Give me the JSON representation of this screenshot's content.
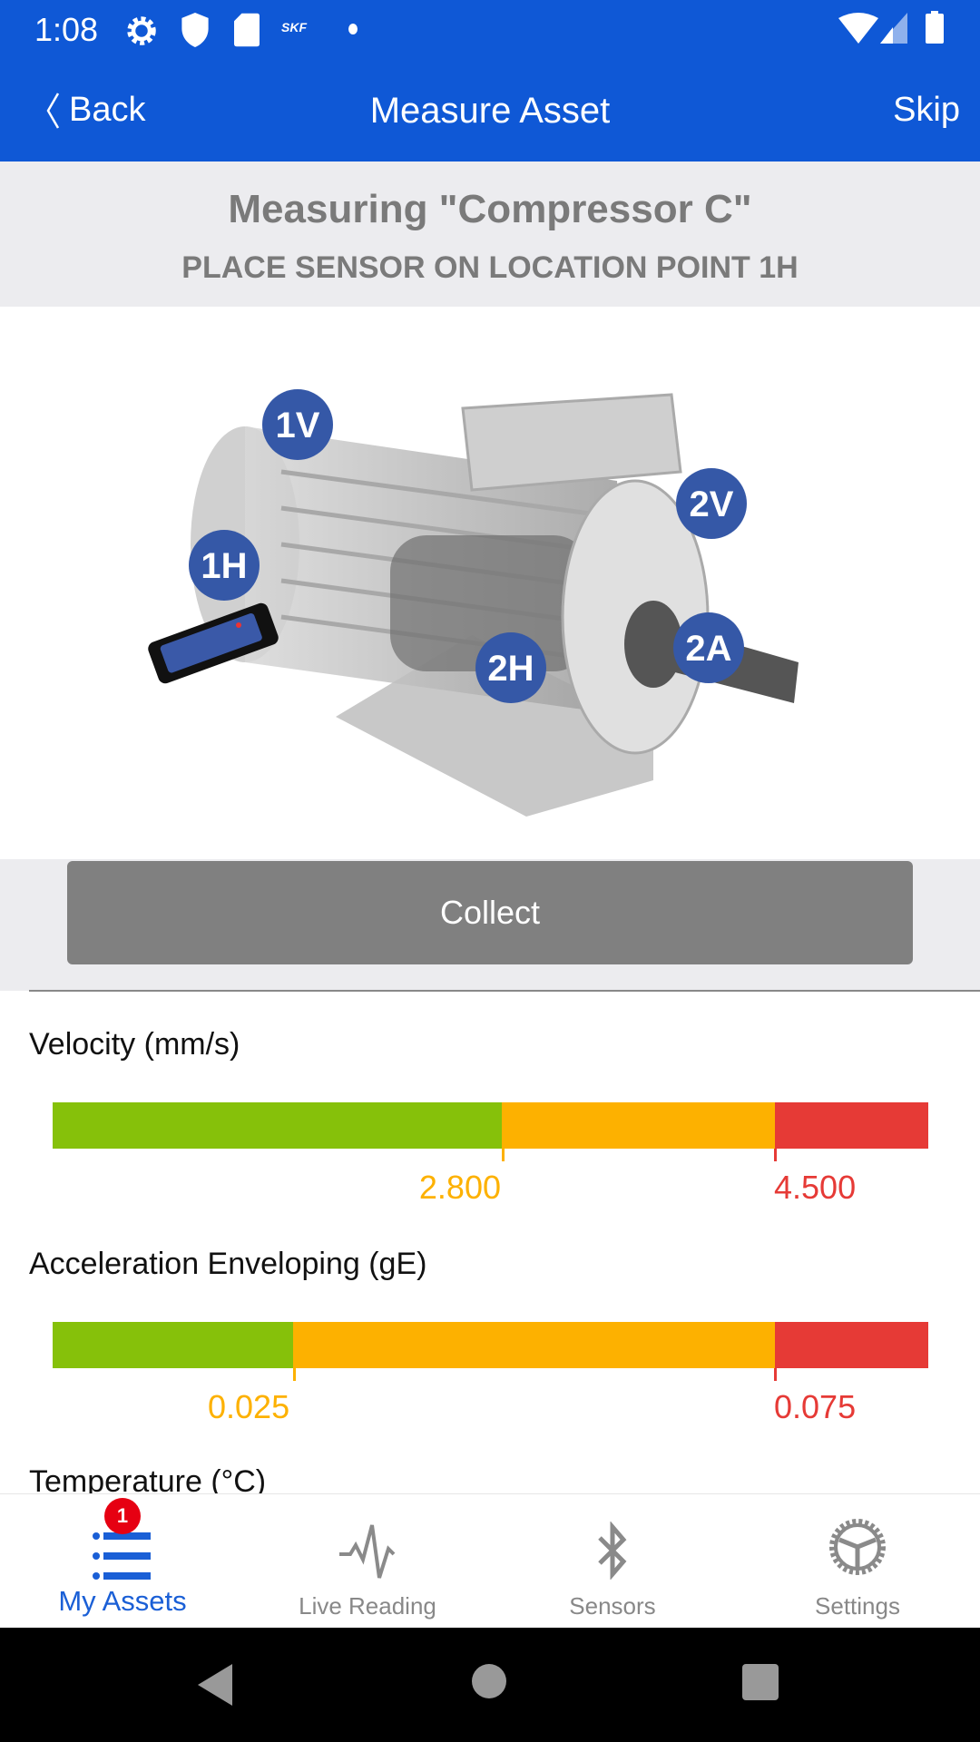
{
  "status_bar": {
    "time": "1:08",
    "icons": [
      "gear-icon",
      "shield-icon",
      "sd-card-icon",
      "skf-logo",
      "dot-icon",
      "wifi-icon",
      "signal-icon",
      "battery-icon"
    ],
    "skf_text": "SKF"
  },
  "app_bar": {
    "back_label": "Back",
    "title": "Measure Asset",
    "skip_label": "Skip"
  },
  "header": {
    "title": "Measuring \"Compressor C\"",
    "instruction": "PLACE SENSOR ON LOCATION POINT 1H"
  },
  "diagram": {
    "points": [
      "1V",
      "2V",
      "1H",
      "2H",
      "2A"
    ],
    "active_point": "1H"
  },
  "collect_label": "Collect",
  "gauges": [
    {
      "label": "Velocity (mm/s)",
      "thresholds": [
        "2.800",
        "4.500"
      ],
      "zones_percent": [
        51.3,
        31.2,
        17.5
      ]
    },
    {
      "label": "Acceleration Enveloping (gE)",
      "thresholds": [
        "0.025",
        "0.075"
      ],
      "zones_percent": [
        27.5,
        55.0,
        17.5
      ]
    },
    {
      "label": "Temperature (°C)"
    }
  ],
  "colors": {
    "brand": "#0f58d6",
    "green": "#86c10a",
    "orange": "#fdb100",
    "red": "#e63a36"
  },
  "nav": {
    "items": [
      {
        "label": "My Assets",
        "icon": "list-icon",
        "badge": "1",
        "active": true
      },
      {
        "label": "Live Reading",
        "icon": "waveform-icon"
      },
      {
        "label": "Sensors",
        "icon": "bluetooth-icon"
      },
      {
        "label": "Settings",
        "icon": "gear-icon"
      }
    ]
  }
}
